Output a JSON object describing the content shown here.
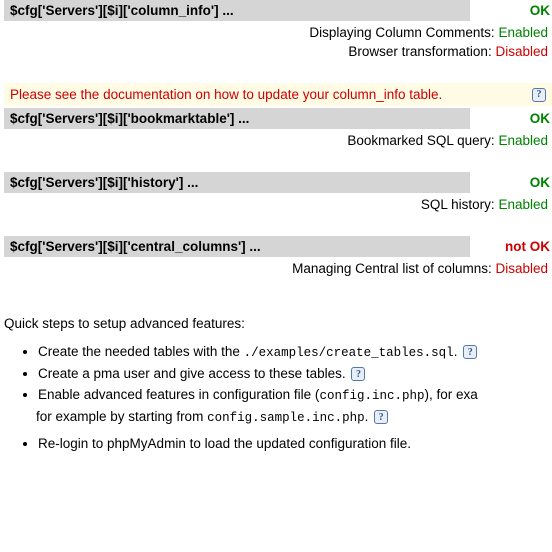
{
  "sections": {
    "column_info": {
      "label": "$cfg['Servers'][$i]['column_info'] ...",
      "status": "OK",
      "status_class": "ok",
      "features": [
        {
          "label": "Displaying Column Comments:",
          "value": "Enabled",
          "value_class": "enabled"
        },
        {
          "label": "Browser transformation:",
          "value": "Disabled",
          "value_class": "disabled"
        }
      ]
    },
    "bookmarktable": {
      "label": "$cfg['Servers'][$i]['bookmarktable'] ...",
      "status": "OK",
      "status_class": "ok",
      "features": [
        {
          "label": "Bookmarked SQL query:",
          "value": "Enabled",
          "value_class": "enabled"
        }
      ]
    },
    "history": {
      "label": "$cfg['Servers'][$i]['history'] ...",
      "status": "OK",
      "status_class": "ok",
      "features": [
        {
          "label": "SQL history:",
          "value": "Enabled",
          "value_class": "enabled"
        }
      ]
    },
    "central_columns": {
      "label": "$cfg['Servers'][$i]['central_columns'] ...",
      "status": "not OK",
      "status_class": "notok",
      "features": [
        {
          "label": "Managing Central list of columns:",
          "value": "Disabled",
          "value_class": "disabled"
        }
      ]
    }
  },
  "notice": {
    "text": "Please see the documentation on how to update your column_info table."
  },
  "steps": {
    "title": "Quick steps to setup advanced features:",
    "item1_a": "Create the needed tables with the ",
    "item1_b": "./examples/create_tables.sql",
    "item1_c": ". ",
    "item2": "Create a pma user and give access to these tables. ",
    "item3_a": "Enable advanced features in configuration file (",
    "item3_b": "config.inc.php",
    "item3_c": "), for exa",
    "item3_d": "for example by starting from ",
    "item3_e": "config.sample.inc.php",
    "item3_f": ". ",
    "item4": "Re-login to phpMyAdmin to load the updated configuration file."
  },
  "help_glyph": "?"
}
